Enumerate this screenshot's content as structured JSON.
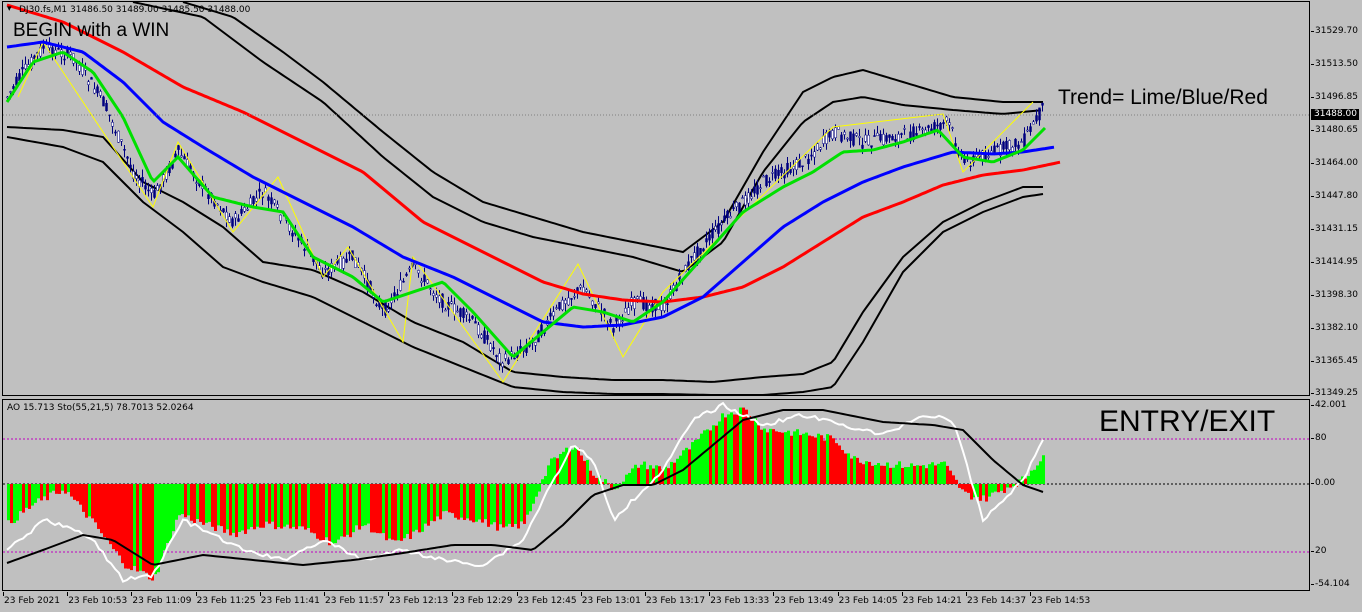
{
  "main_chart": {
    "symbol_info": "DJ30.fs,M1  31486.50 31489.00 31485.50 31488.00",
    "headline": "BEGIN with a WIN",
    "legend_note": "Trend= Lime/Blue/Red",
    "current_price": "31488.00",
    "price_labels": [
      "31529.70",
      "31513.50",
      "31496.85",
      "31480.65",
      "31464.00",
      "31447.80",
      "31431.15",
      "31414.95",
      "31398.30",
      "31382.10",
      "31365.45",
      "31349.25"
    ],
    "colors": {
      "fast_ma": "#00e000",
      "mid_ma": "#0000ff",
      "slow_ma": "#ff0000",
      "bands": "#000000",
      "candle": "#000080",
      "zigzag": "#ffff00"
    }
  },
  "sub_chart": {
    "indicator_info": "AO 15.713  Sto(55,21,5) 78.7013 52.0264",
    "headline": "ENTRY/EXIT",
    "level_labels": [
      "42.001",
      "80",
      "0.00",
      "20",
      "-54.104"
    ],
    "colors": {
      "ao_up": "#00ff00",
      "ao_down": "#ff0000",
      "sto_main": "#ffffff",
      "sto_signal": "#000000",
      "levels": "#c000c0"
    }
  },
  "time_labels": [
    "23 Feb 2021",
    "23 Feb 10:53",
    "23 Feb 11:09",
    "23 Feb 11:25",
    "23 Feb 11:41",
    "23 Feb 11:57",
    "23 Feb 12:13",
    "23 Feb 12:29",
    "23 Feb 12:45",
    "23 Feb 13:01",
    "23 Feb 13:17",
    "23 Feb 13:33",
    "23 Feb 13:49",
    "23 Feb 14:05",
    "23 Feb 14:21",
    "23 Feb 14:37",
    "23 Feb 14:53"
  ]
}
